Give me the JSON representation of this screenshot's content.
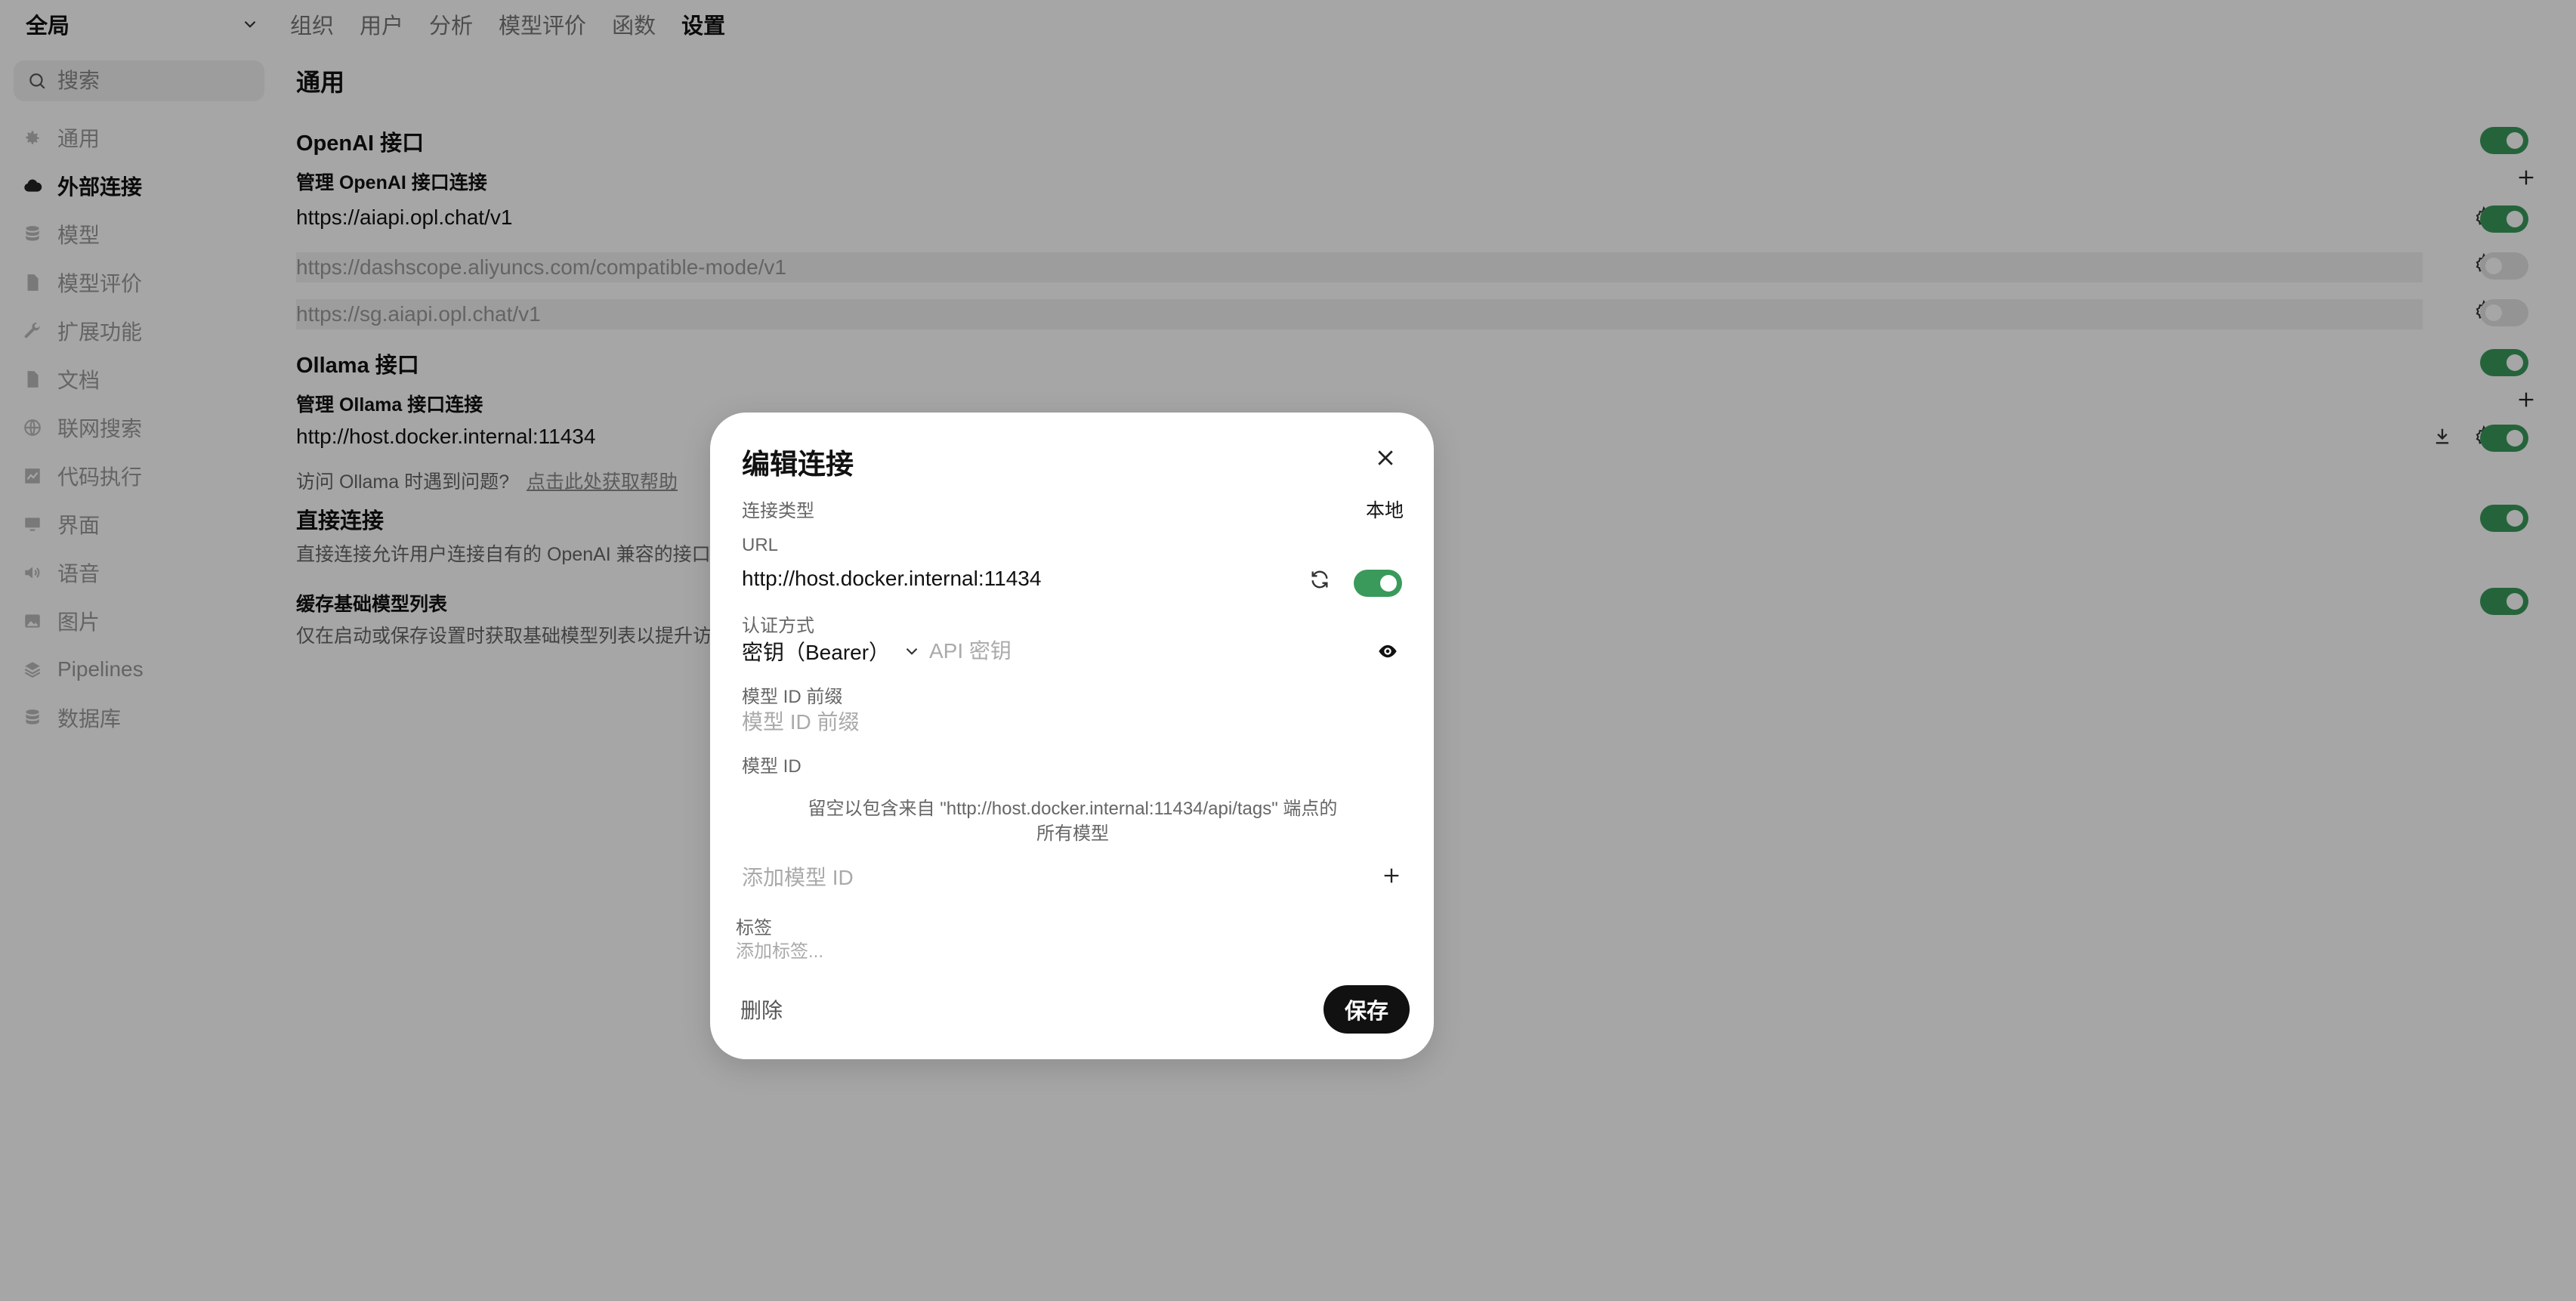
{
  "sidebar": {
    "scope": "全局",
    "search_placeholder": "搜索",
    "items": [
      {
        "label": "通用",
        "icon": "gear-icon"
      },
      {
        "label": "外部连接",
        "icon": "cloud-icon"
      },
      {
        "label": "模型",
        "icon": "database-icon"
      },
      {
        "label": "模型评价",
        "icon": "document-icon"
      },
      {
        "label": "扩展功能",
        "icon": "wrench-icon"
      },
      {
        "label": "文档",
        "icon": "document-icon"
      },
      {
        "label": "联网搜索",
        "icon": "globe-icon"
      },
      {
        "label": "代码执行",
        "icon": "chart-icon"
      },
      {
        "label": "界面",
        "icon": "monitor-icon"
      },
      {
        "label": "语音",
        "icon": "speaker-icon"
      },
      {
        "label": "图片",
        "icon": "image-icon"
      },
      {
        "label": "Pipelines",
        "icon": "layers-icon"
      },
      {
        "label": "数据库",
        "icon": "database-icon"
      }
    ],
    "active_index": 1
  },
  "topnav": {
    "tabs": [
      "组织",
      "用户",
      "分析",
      "模型评价",
      "函数",
      "设置"
    ],
    "active_index": 5
  },
  "main": {
    "section_title": "通用",
    "openai": {
      "title": "OpenAI 接口",
      "manage_label": "管理 OpenAI 接口连接",
      "connections": [
        {
          "url": "https://aiapi.opl.chat/v1",
          "enabled": true
        },
        {
          "url": "https://dashscope.aliyuncs.com/compatible-mode/v1",
          "enabled": false
        },
        {
          "url": "https://sg.aiapi.opl.chat/v1",
          "enabled": false
        }
      ]
    },
    "ollama": {
      "title": "Ollama 接口",
      "manage_label": "管理 Ollama 接口连接",
      "connection_url": "http://host.docker.internal:11434",
      "help_prefix": "访问 Ollama 时遇到问题?",
      "help_link": "点击此处获取帮助"
    },
    "direct": {
      "title": "直接连接",
      "desc": "直接连接允许用户连接自有的 OpenAI 兼容的接口"
    },
    "cache": {
      "title": "缓存基础模型列表",
      "desc": "仅在启动或保存设置时获取基础模型列表以提升访问"
    }
  },
  "modal": {
    "title": "编辑连接",
    "connection_type_label": "连接类型",
    "connection_type_value": "本地",
    "url_label": "URL",
    "url_value": "http://host.docker.internal:11434",
    "auth_label": "认证方式",
    "auth_value": "密钥（Bearer）",
    "api_key_placeholder": "API 密钥",
    "prefix_label": "模型 ID 前缀",
    "prefix_placeholder": "模型 ID 前缀",
    "model_id_label": "模型 ID",
    "model_id_hint": "留空以包含来自 \"http://host.docker.internal:11434/api/tags\" 端点的所有模型",
    "add_model_placeholder": "添加模型 ID",
    "tags_label": "标签",
    "tags_placeholder": "添加标签...",
    "delete_label": "删除",
    "save_label": "保存"
  }
}
